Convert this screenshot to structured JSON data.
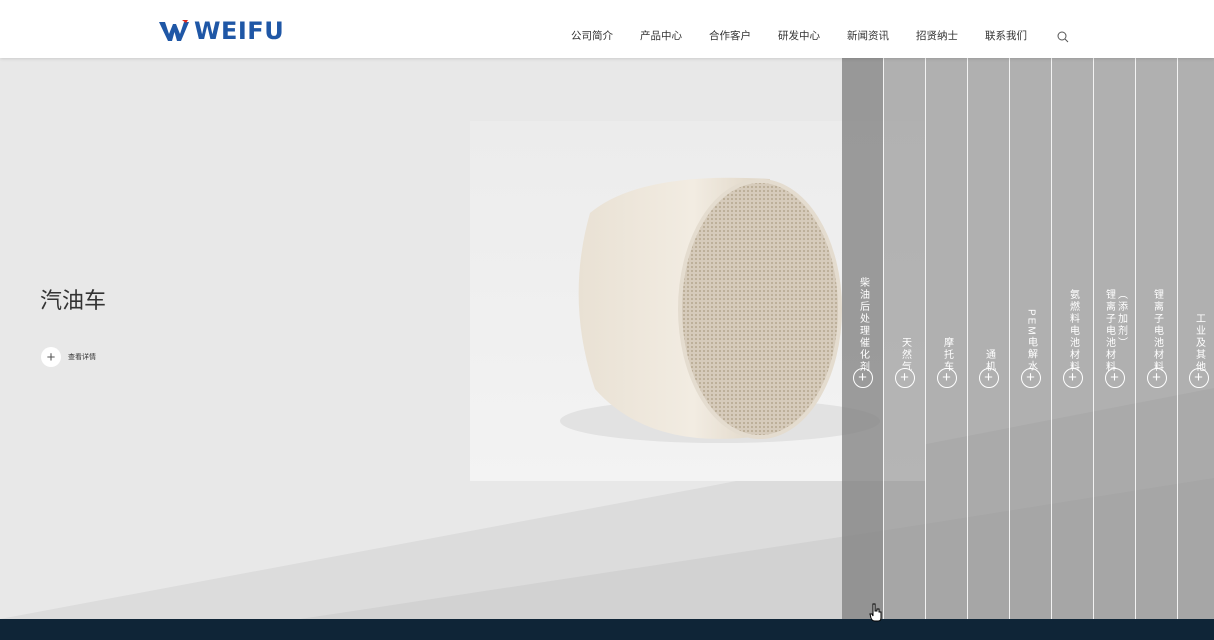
{
  "header": {
    "logo": {
      "text": "WEIFU",
      "brand_color": "#1f57a6",
      "accent_color": "#d9261c"
    },
    "nav": [
      {
        "label": "公司简介"
      },
      {
        "label": "产品中心"
      },
      {
        "label": "合作客户"
      },
      {
        "label": "研发中心"
      },
      {
        "label": "新闻资讯"
      },
      {
        "label": "招贤纳士"
      },
      {
        "label": "联系我们"
      }
    ],
    "search_icon": "search-icon"
  },
  "hero": {
    "title": "汽油车",
    "details_label": "查看详情",
    "details_icon": "plus-icon"
  },
  "panels": [
    {
      "label": "柴油后处理催化剂"
    },
    {
      "label": "天然气"
    },
    {
      "label": "摩托车"
    },
    {
      "label": "通机"
    },
    {
      "label": "PEM电解水"
    },
    {
      "label": "氨燃料电池材料"
    },
    {
      "label": "锂离子电池材料",
      "label2": "（添加剂）"
    },
    {
      "label": "锂离子电池材料"
    },
    {
      "label": "工业及其他"
    }
  ],
  "colors": {
    "footer": "#0f2537",
    "panel_overlay": "#8a8a8a"
  }
}
